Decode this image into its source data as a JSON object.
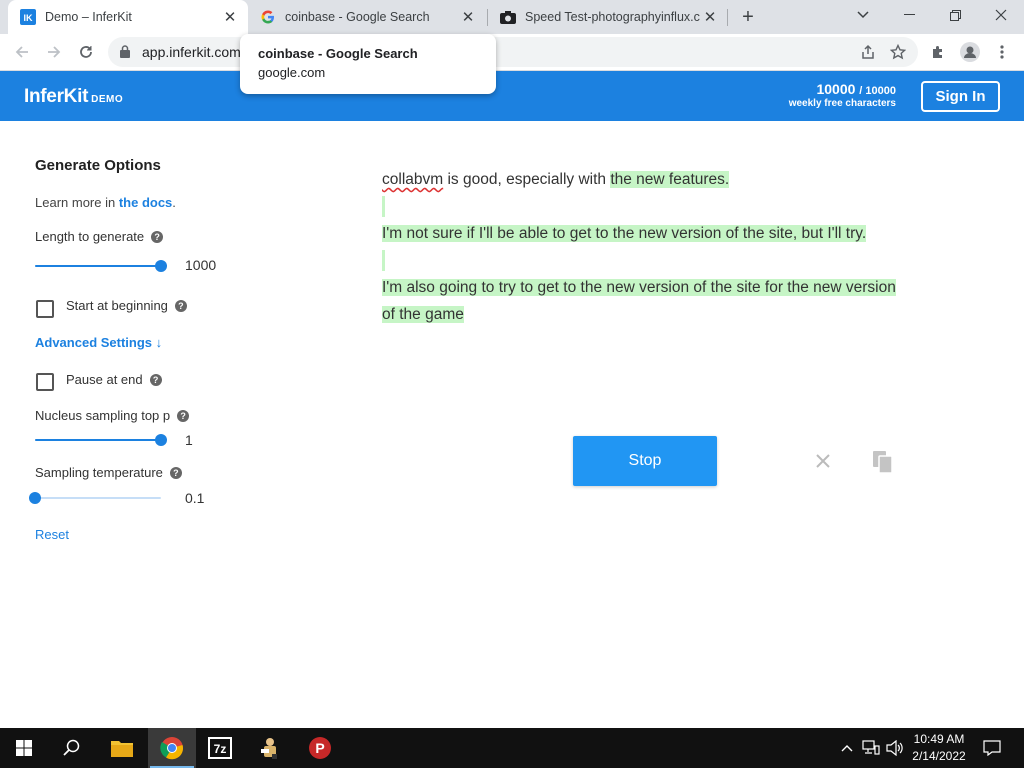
{
  "browser": {
    "tabs": [
      {
        "title": "Demo – InferKit",
        "favicon": "inferkit-icon",
        "active": true
      },
      {
        "title": "coinbase - Google Search",
        "favicon": "google-icon",
        "active": false
      },
      {
        "title": "Speed Test-photographyinflux.com",
        "favicon": "camera-icon",
        "active": false
      }
    ],
    "hover_card": {
      "title": "coinbase - Google Search",
      "domain": "google.com"
    },
    "url": "app.inferkit.com"
  },
  "header": {
    "logo": "InferKit",
    "logo_suffix": "DEMO",
    "quota_used": "10000",
    "quota_total": "/ 10000",
    "quota_label": "weekly free characters",
    "signin_label": "Sign In",
    "accent_color": "#1c81e0"
  },
  "options": {
    "title": "Generate Options",
    "learn_prefix": "Learn more in ",
    "learn_link": "the docs",
    "learn_suffix": ".",
    "length_label": "Length to generate",
    "length_value": "1000",
    "length_fraction": 1.0,
    "start_label": "Start at beginning",
    "start_checked": false,
    "advanced_label": "Advanced Settings ↓",
    "pause_label": "Pause at end",
    "pause_checked": false,
    "nucleus_label": "Nucleus sampling top p",
    "nucleus_value": "1",
    "nucleus_fraction": 1.0,
    "temp_label": "Sampling temperature",
    "temp_value": "0.1",
    "temp_fraction": 0.0,
    "reset_label": "Reset"
  },
  "output": {
    "prompt_word": "collabvm",
    "prompt_rest": " is good, especially with ",
    "gen_1": "the new features.",
    "gen_2": "I'm not sure if I'll be able to get to the new version of the site, but I'll try.",
    "gen_3": "I'm also going to try to get to the new version of the site for the new version of the game"
  },
  "actions": {
    "stop_label": "Stop"
  },
  "taskbar": {
    "time": "10:49 AM",
    "date": "2/14/2022"
  }
}
